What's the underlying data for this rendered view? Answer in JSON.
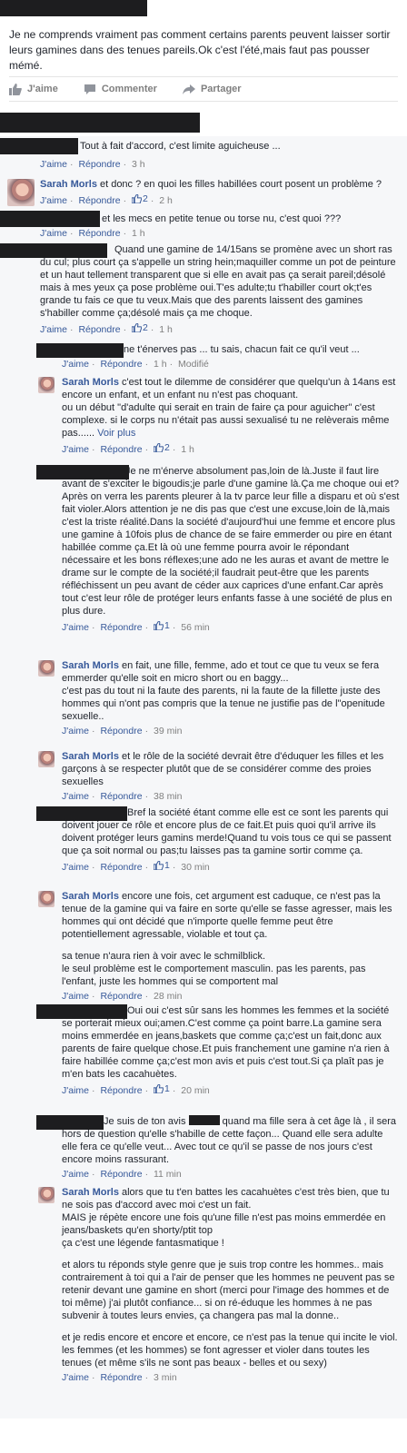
{
  "post": {
    "text": "Je ne comprends vraiment pas comment certains parents peuvent laisser sortir leurs gamines dans des tenues pareils.Ok c'est l'été,mais faut pas pousser mémé.",
    "actions": {
      "like": "J'aime",
      "comment": "Commenter",
      "share": "Partager"
    }
  },
  "meta_labels": {
    "like": "J'aime",
    "reply": "Répondre",
    "modified": "Modifié",
    "see_more": "Voir plus"
  },
  "colors": {
    "link": "#365899",
    "meta": "#7f7f7f",
    "redaction": "#1d1d1f",
    "background": "#e9ebee"
  },
  "comments": [
    {
      "author": "",
      "redacted": true,
      "text": "Tout à fait d'accord, c'est limite aguicheuse ...",
      "likes": "",
      "time": "3 h"
    },
    {
      "author": "Sarah Morls",
      "redacted": false,
      "text": "et donc ? en quoi les filles habillées court posent un problème ?",
      "likes": "2",
      "time": "2 h"
    },
    {
      "author": "",
      "redacted": true,
      "text": "et les mecs en petite tenue ou torse nu, c'est quoi ???",
      "likes": "",
      "time": "1 h"
    },
    {
      "author": "",
      "redacted": true,
      "text": "Quand une gamine de 14/15ans se promène avec un short ras du cul; plus court ça s'appelle un string hein;maquiller comme un pot de peinture et un haut tellement transparent que si elle en avait pas ça serait pareil;désolé mais à mes yeux ça pose problème oui.T'es adulte;tu t'habiller court ok;t'es grande tu fais ce que tu veux.Mais que des parents laissent des gamines s'habiller comme ça;désolé mais ça me choque.",
      "likes": "2",
      "time": "1 h"
    }
  ],
  "replies": [
    {
      "author": "",
      "redacted": true,
      "text": "ne t'énerves pas ... tu sais, chacun fait ce qu'il veut ...",
      "likes": "",
      "time": "1 h",
      "modified": true
    },
    {
      "author": "Sarah Morls",
      "redacted": false,
      "text": "c'est tout le dilemme de considérer que quelqu'un à 14ans est encore un enfant, et un enfant nu n'est pas choquant.",
      "text2": "ou un début \"d'adulte qui serait en train de faire ça pour aguicher\" c'est complexe. si le corps nu n'était pas aussi sexualisé tu ne relèverais même pas......",
      "likes": "2",
      "time": "1 h"
    },
    {
      "author": "",
      "redacted": true,
      "text": "Je ne m'énerve absolument pas,loin de là.Juste il faut lire avant de s'exciter le bigoudis;je parle d'une gamine là.Ça me choque oui et?Après on verra les parents pleurer à la tv parce leur fille a disparu et où s'est fait violer.Alors attention je ne dis pas que c'est une excuse,loin de là,mais c'est la triste réalité.Dans la société d'aujourd'hui une femme et encore plus une gamine à 10fois plus de chance de se faire emmerder ou pire en étant habillée comme ça.Et là où une femme pourra avoir le répondant nécessaire et les bons réflexes;une ado ne les auras et avant de mettre le drame sur le compte de la société;il faudrait peut-être que les parents réfléchissent un peu avant de céder aux caprices d'une enfant.Car après tout c'est leur rôle de protéger leurs enfants fasse à une société de plus en plus dure.",
      "likes": "1",
      "time": "56 min"
    },
    {
      "author": "Sarah Morls",
      "redacted": false,
      "text": "en fait, une fille, femme, ado et tout ce que tu veux se fera emmerder qu'elle soit en micro short ou en baggy...",
      "text2": "c'est pas du tout ni la faute des parents, ni la faute de la fillette juste des hommes qui n'ont pas compris que la tenue ne justifie pas de l\"openitude sexuelle..",
      "likes": "",
      "time": "39 min"
    },
    {
      "author": "Sarah Morls",
      "redacted": false,
      "text": "et le rôle de la société devrait être d'éduquer les filles et les garçons à se respecter plutôt que de se considérer comme des proies sexuelles",
      "likes": "",
      "time": "38 min"
    },
    {
      "author": "",
      "redacted": true,
      "text": "Bref la société étant comme elle est ce sont les parents qui doivent jouer ce rôle et encore plus de ce fait.Et puis quoi qu'il arrive ils doivent protéger leurs gamins merde!Quand tu vois tous ce qui se passent que ça soit normal ou pas;tu laisses pas ta gamine sortir comme ça.",
      "likes": "1",
      "time": "30 min"
    },
    {
      "author": "Sarah Morls",
      "redacted": false,
      "text": "encore une fois, cet argument est caduque, ce n'est pas la tenue de la gamine qui va faire en sorte qu'elle se fasse agresser, mais les hommes qui ont décidé que n'importe quelle femme peut être potentiellement agressable, violable et tout ça.",
      "text2": "sa tenue n'aura rien à voir avec le schmilblick.",
      "text3": "le seul problème est le comportement masculin. pas les parents, pas l'enfant, juste les hommes qui se comportent mal",
      "likes": "",
      "time": "28 min"
    },
    {
      "author": "",
      "redacted": true,
      "text": "Oui oui c'est sûr sans les hommes les femmes et la société se porterait mieux oui;amen.C'est comme ça point barre.La gamine sera moins emmerdée en jeans,baskets que comme ça;c'est un fait,donc aux parents de faire quelque chose.Et puis franchement une gamine n'a rien à faire habillée comme ça;c'est mon avis et puis c'est tout.Si ça plaît pas je m'en bats les cacahuètes.",
      "likes": "1",
      "time": "20 min"
    },
    {
      "author": "",
      "redacted": true,
      "text_a": "Je suis de ton avis",
      "text_b": "quand ma fille sera à cet âge là , il sera hors de question qu'elle s'habille de cette façon... Quand elle sera adulte elle fera ce qu'elle veut... Avec tout ce qu'il se passe de nos jours c'est encore moins rassurant.",
      "likes": "",
      "time": "11 min"
    },
    {
      "author": "Sarah Morls",
      "redacted": false,
      "text": "alors que tu t'en battes les cacahuètes c'est très bien, que tu ne sois pas d'accord avec moi c'est un fait.",
      "text2": "MAIS je répète encore une fois qu'une fille n'est pas moins emmerdée en jeans/baskets qu'en shorty/ptit top",
      "text3": "ça c'est une légende fantasmatique !",
      "text4": "et alors tu réponds style genre que je suis trop contre les hommes.. mais contrairement à toi qui a l'air de penser que les hommes ne peuvent pas se retenir devant une gamine en short (merci pour l'image des hommes et de toi même) j'ai plutôt confiance... si on ré-éduque les hommes à ne pas subvenir à toutes leurs envies, ça changera pas mal la donne..",
      "text5": "et je redis encore et encore et encore, ce n'est pas la tenue qui incite le viol. les femmes (et les hommes) se font agresser et violer dans toutes les tenues (et même s'ils ne sont pas beaux - belles et ou sexy)",
      "likes": "",
      "time": "3 min"
    }
  ]
}
